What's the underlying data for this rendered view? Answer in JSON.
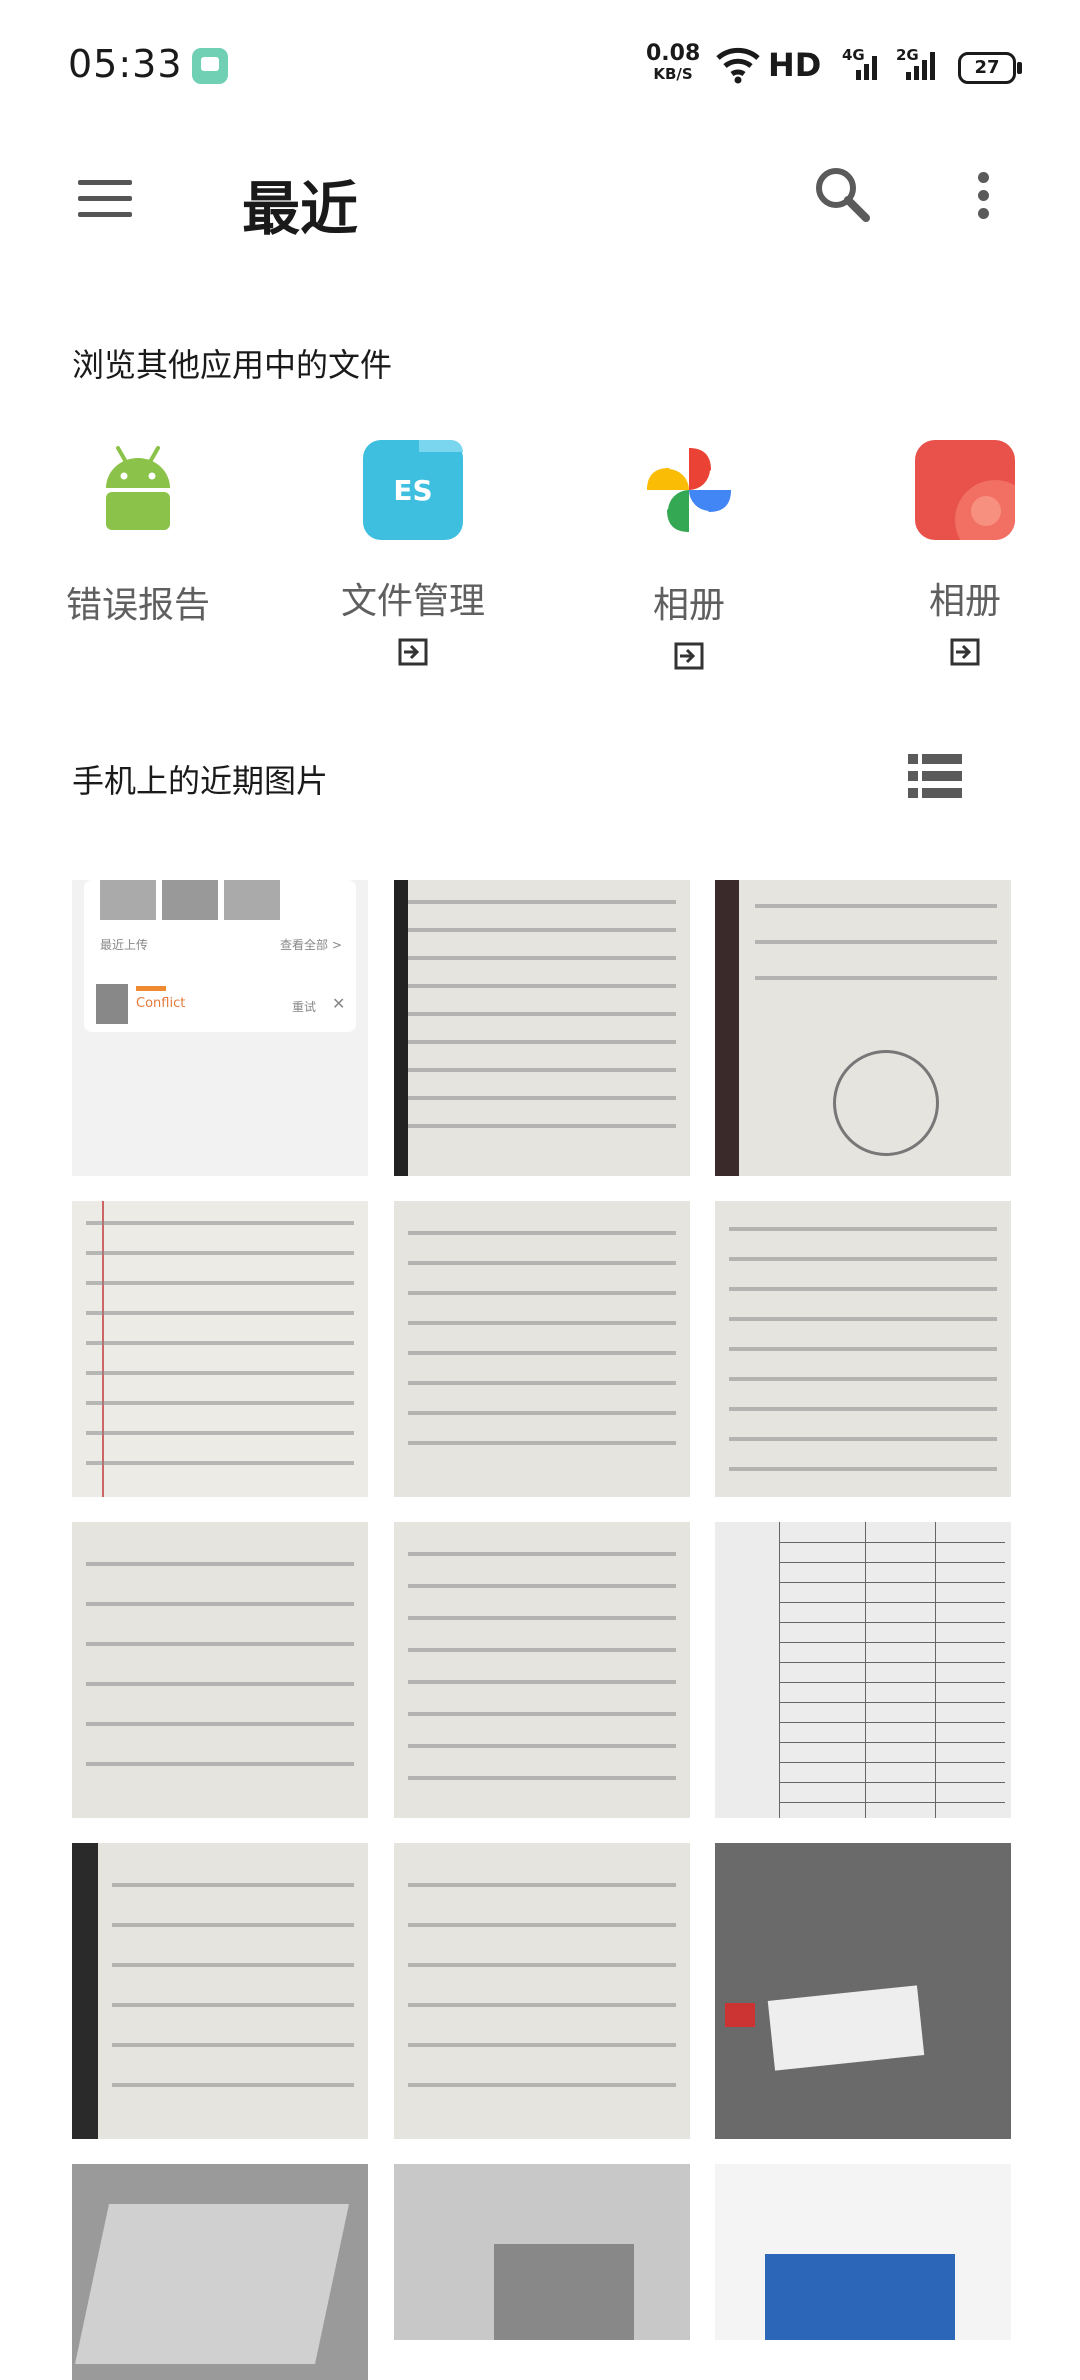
{
  "status_bar": {
    "time": "05:33",
    "net_speed_value": "0.08",
    "net_speed_unit": "KB/S",
    "hd_label": "HD",
    "signal1_tag": "4G",
    "signal2_tag": "2G",
    "battery_level": "27"
  },
  "app_bar": {
    "title": "最近"
  },
  "other_apps": {
    "heading": "浏览其他应用中的文件",
    "items": [
      {
        "label": "错误报告",
        "icon": "android-icon"
      },
      {
        "label": "文件管理",
        "icon": "es-file-icon",
        "icon_text": "ES"
      },
      {
        "label": "相册",
        "icon": "google-photos-icon"
      },
      {
        "label": "相册",
        "icon": "gallery-icon"
      }
    ]
  },
  "recent_images": {
    "heading": "手机上的近期图片",
    "thumb_screenshot": {
      "recent_upload": "最近上传",
      "view_all": "查看全部 >",
      "conflict": "Conflict",
      "retry": "重试"
    }
  },
  "colors": {
    "accent": "#3fbfe0",
    "android_green": "#8bc34a",
    "gallery_red": "#e8524a"
  }
}
